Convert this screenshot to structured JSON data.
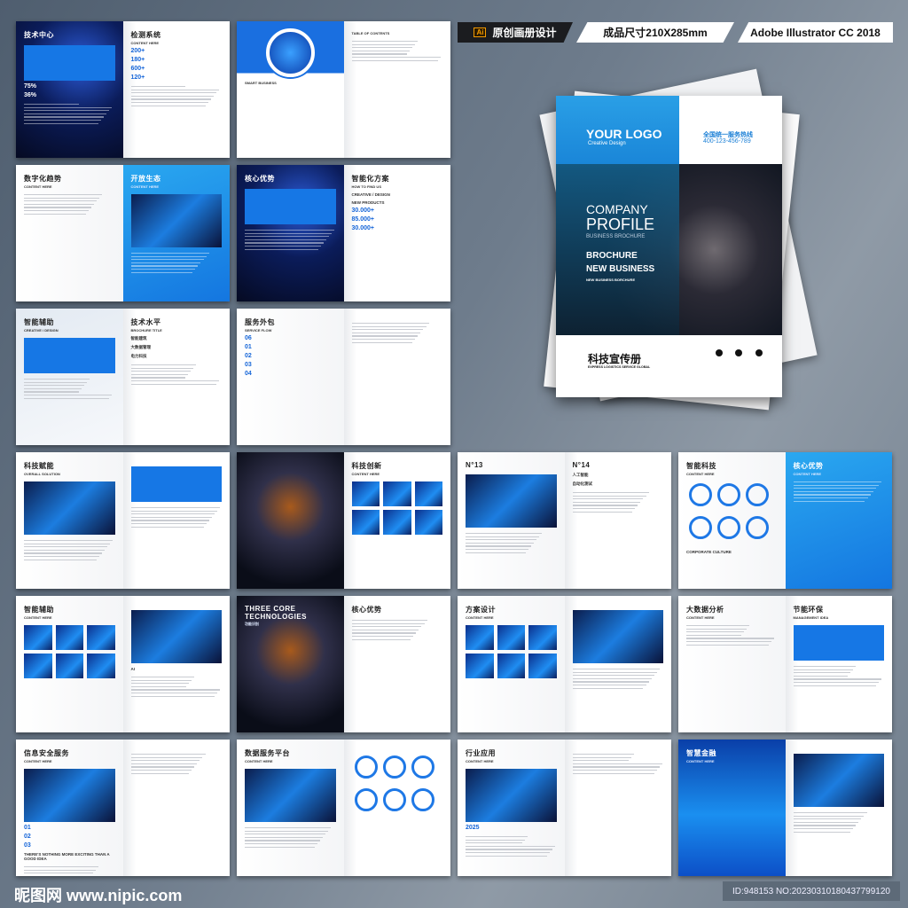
{
  "banner": {
    "ai_icon": "Ai",
    "original": "原创画册设计",
    "size": "成品尺寸210X285mm",
    "software": "Adobe Illustrator CC 2018"
  },
  "cover": {
    "logo": "YOUR LOGO",
    "logo_sub": "Creative Design",
    "hotline_label": "全国统一服务热线",
    "hotline": "400-123-456-789",
    "title1": "COMPANY",
    "title2": "PROFILE",
    "subtitle": "BUSINESS BROCHURE",
    "line1": "BROCHURE",
    "line2": "NEW BUSINESS",
    "line3": "NEW BUSINESS BORCHURE",
    "zh_title": "科技宣传册",
    "zh_sub": "EXPRESS LOGISTICS SERVICE GLOBAL",
    "icons": [
      "phone-icon",
      "mail-icon",
      "chat-icon"
    ]
  },
  "spreads": [
    {
      "left": {
        "theme": "dark",
        "title": "技术中心",
        "texts": [
          "75%",
          "36%"
        ],
        "deco": "bluebox"
      },
      "right": {
        "theme": "white",
        "title": "检测系统",
        "sub": "CONTENT HERE",
        "texts": [
          "200+",
          "180+",
          "600+",
          "120+"
        ],
        "deco": "lines"
      }
    },
    {
      "left": {
        "theme": "white",
        "title": "",
        "sub": "SMART BUSINESS",
        "deco": "circleimg"
      },
      "right": {
        "theme": "white",
        "title": "",
        "sub": "TABLE OF CONTENTS",
        "deco": "lines"
      }
    },
    {
      "left": {
        "theme": "white",
        "title": "数字化趋势",
        "sub": "CONTENT HERE",
        "deco": "lines"
      },
      "right": {
        "theme": "blue",
        "title": "开放生态",
        "sub": "CONTENT HERE",
        "deco": "photo"
      }
    },
    {
      "left": {
        "theme": "dark",
        "title": "核心优势",
        "sub": "",
        "deco": "bluebox"
      },
      "right": {
        "theme": "white",
        "title": "智能化方案",
        "sub": "HOW TO FIND US",
        "texts": [
          "CREATIVE / DESIGN",
          "NEW PRODUCTS",
          "30.000+",
          "85.000+",
          "30.000+"
        ],
        "deco": "none"
      }
    },
    {
      "left": {
        "theme": "grey",
        "title": "智能辅助",
        "sub": "CREATIVE / DESIGN",
        "deco": "bluebox"
      },
      "right": {
        "theme": "white",
        "title": "技术水平",
        "sub": "BROCHURE TITLE",
        "texts": [
          "智能建筑",
          "大数据管理",
          "电力科技"
        ],
        "deco": "lines"
      }
    },
    {
      "left": {
        "theme": "white",
        "title": "服务外包",
        "sub": "SERVICE FLOW",
        "texts": [
          "06",
          "01",
          "02",
          "03",
          "04"
        ],
        "deco": "none"
      },
      "right": {
        "theme": "white",
        "title": "",
        "sub": "",
        "deco": "lines"
      }
    },
    {
      "left": {
        "theme": "white",
        "title": "科技赋能",
        "sub": "OVERALL SOLUTION",
        "deco": "photo"
      },
      "right": {
        "theme": "white",
        "title": "",
        "sub": "",
        "deco": "bluebox"
      }
    },
    {
      "left": {
        "theme": "darkphoto",
        "title": "",
        "sub": "",
        "deco": "none"
      },
      "right": {
        "theme": "white",
        "title": "科技创新",
        "sub": "CONTENT HERE",
        "deco": "tiles"
      }
    },
    {
      "left": {
        "theme": "white",
        "title": "N°13",
        "sub": "",
        "deco": "photo"
      },
      "right": {
        "theme": "white",
        "title": "N°14",
        "sub": "",
        "texts": [
          "人工智能",
          "自动化测试"
        ],
        "deco": "lines"
      }
    },
    {
      "left": {
        "theme": "white",
        "title": "智能科技",
        "sub": "CONTENT HERE",
        "texts": [
          "CORPORATE CULTURE"
        ],
        "deco": "circles"
      },
      "right": {
        "theme": "blue",
        "title": "核心优势",
        "sub": "CONTENT HERE",
        "deco": "lines"
      }
    },
    {
      "left": {
        "theme": "white",
        "title": "智能辅助",
        "sub": "CONTENT HERE",
        "deco": "tiles"
      },
      "right": {
        "theme": "white",
        "title": "",
        "sub": "",
        "texts": [
          "AI"
        ],
        "deco": "photo"
      }
    },
    {
      "left": {
        "theme": "darkphoto",
        "title": "THREE CORE TECHNOLOGIES",
        "sub": "功能识别",
        "deco": "none"
      },
      "right": {
        "theme": "white",
        "title": "核心优势",
        "sub": "",
        "deco": "lines"
      }
    },
    {
      "left": {
        "theme": "white",
        "title": "方案设计",
        "sub": "CONTENT HERE",
        "deco": "tiles"
      },
      "right": {
        "theme": "white",
        "title": "",
        "sub": "",
        "deco": "photo"
      }
    },
    {
      "left": {
        "theme": "white",
        "title": "大数据分析",
        "sub": "CONTENT HERE",
        "deco": "lines"
      },
      "right": {
        "theme": "white",
        "title": "节能环保",
        "sub": "MANAGEMENT IDEA",
        "deco": "bluebox"
      }
    },
    {
      "left": {
        "theme": "white",
        "title": "信息安全服务",
        "sub": "CONTENT HERE",
        "texts": [
          "01",
          "02",
          "03",
          "THERE'S NOTHING MORE EXCITING THAN A GOOD IDEA"
        ],
        "deco": "photo"
      },
      "right": {
        "theme": "white",
        "title": "",
        "sub": "",
        "deco": "lines"
      }
    },
    {
      "left": {
        "theme": "white",
        "title": "数据服务平台",
        "sub": "CONTENT HERE",
        "deco": "photo"
      },
      "right": {
        "theme": "white",
        "title": "",
        "sub": "",
        "deco": "circles"
      }
    },
    {
      "left": {
        "theme": "white",
        "title": "行业应用",
        "sub": "CONTENT HERE",
        "texts": [
          "2025"
        ],
        "deco": "photo"
      },
      "right": {
        "theme": "white",
        "title": "",
        "sub": "",
        "deco": "lines"
      }
    },
    {
      "left": {
        "theme": "city",
        "title": "智慧金融",
        "sub": "CONTENT HERE",
        "deco": "none"
      },
      "right": {
        "theme": "white",
        "title": "",
        "sub": "",
        "deco": "photo"
      }
    }
  ],
  "footer": {
    "site": "昵图网 www.nipic.com",
    "id": "ID:948153 NO:20230310180437799120"
  }
}
